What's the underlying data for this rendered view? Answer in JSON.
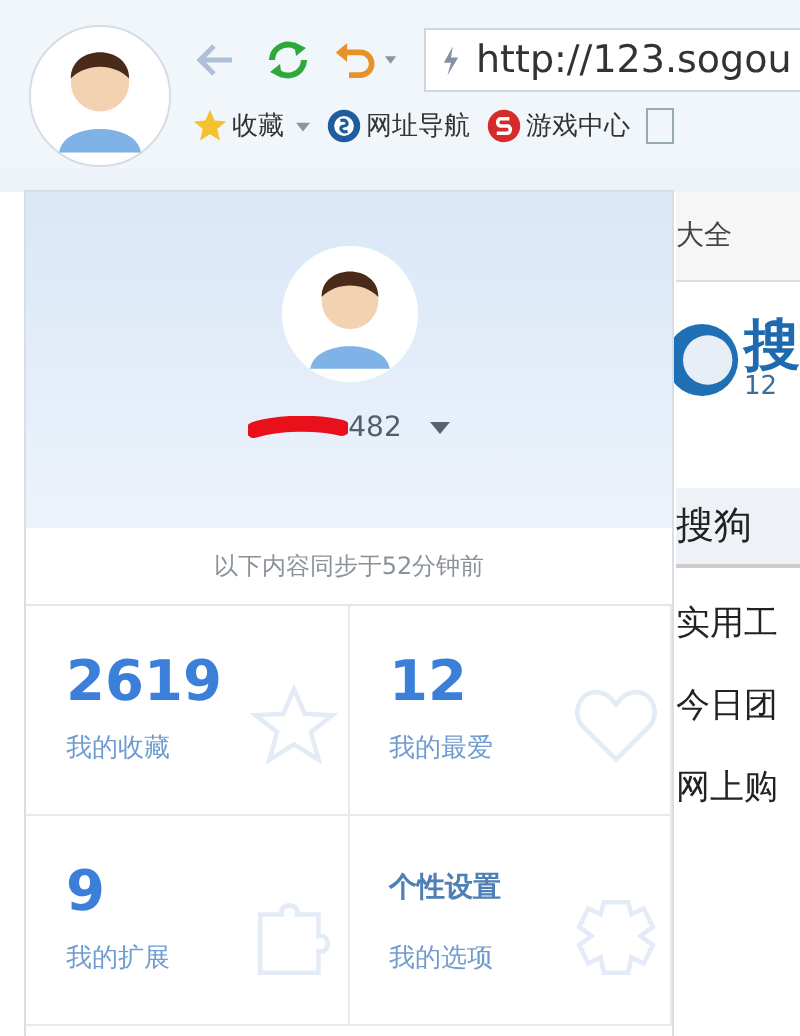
{
  "toolbar": {
    "address": "http://123.sogou"
  },
  "bookmarks": [
    {
      "label": "收藏",
      "kind": "menu"
    },
    {
      "label": "网址导航",
      "kind": "nav"
    },
    {
      "label": "游戏中心",
      "kind": "game"
    }
  ],
  "page": {
    "tab_text": "大全",
    "logo_text": "搜",
    "logo_sub": "12",
    "heading": "搜狗",
    "links": [
      "实用工",
      "今日团",
      "网上购"
    ]
  },
  "panel": {
    "username": "482",
    "sync_note": "以下内容同步于52分钟前",
    "tiles": [
      {
        "value": "2619",
        "label": "我的收藏",
        "kind": "count"
      },
      {
        "value": "12",
        "label": "我的最爱",
        "kind": "count"
      },
      {
        "value": "9",
        "label": "我的扩展",
        "kind": "count"
      },
      {
        "value": "个性设置",
        "label": "我的选项",
        "kind": "setting"
      }
    ]
  }
}
